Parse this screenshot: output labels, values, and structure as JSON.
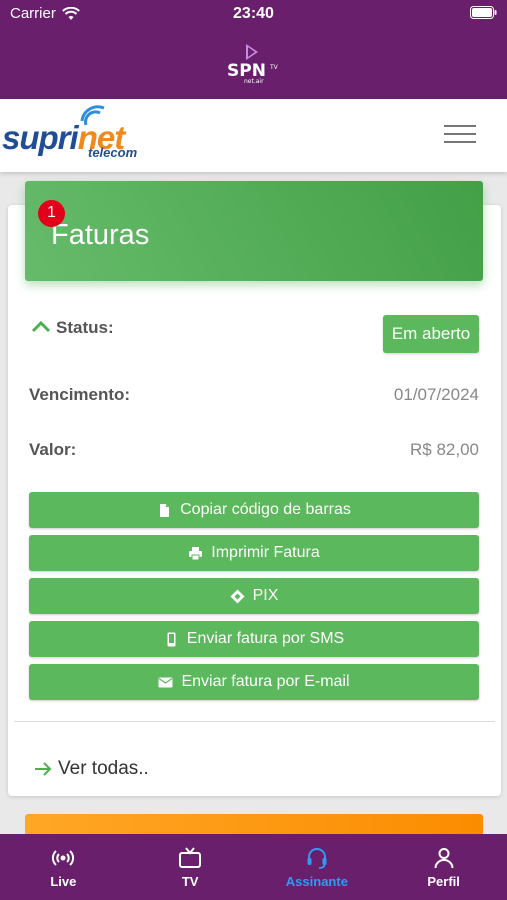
{
  "status_bar": {
    "carrier": "Carrier",
    "time": "23:40"
  },
  "brand": {
    "name_part1": "supri",
    "name_part2": "net",
    "sub": "telecom"
  },
  "invoice": {
    "title": "Faturas",
    "badge_count": "1",
    "status_label": "Status:",
    "status_value": "Em aberto",
    "due_label": "Vencimento:",
    "due_value": "01/07/2024",
    "amount_label": "Valor:",
    "amount_value": "R$ 82,00"
  },
  "actions": {
    "copy_barcode": "Copiar código de barras",
    "print": "Imprimir Fatura",
    "pix": "PIX",
    "sms": "Enviar fatura por SMS",
    "email": "Enviar fatura por E-mail"
  },
  "see_all": "Ver todas..",
  "tabs": [
    {
      "label": "Live",
      "icon": "live-broadcast-icon"
    },
    {
      "label": "TV",
      "icon": "tv-icon"
    },
    {
      "label": "Assinante",
      "icon": "headset-icon"
    },
    {
      "label": "Perfil",
      "icon": "person-icon"
    }
  ],
  "colors": {
    "header": "#6a1f6d",
    "green": "#5cb85c",
    "active_tab": "#2e9cf2",
    "badge": "#e3001b"
  }
}
